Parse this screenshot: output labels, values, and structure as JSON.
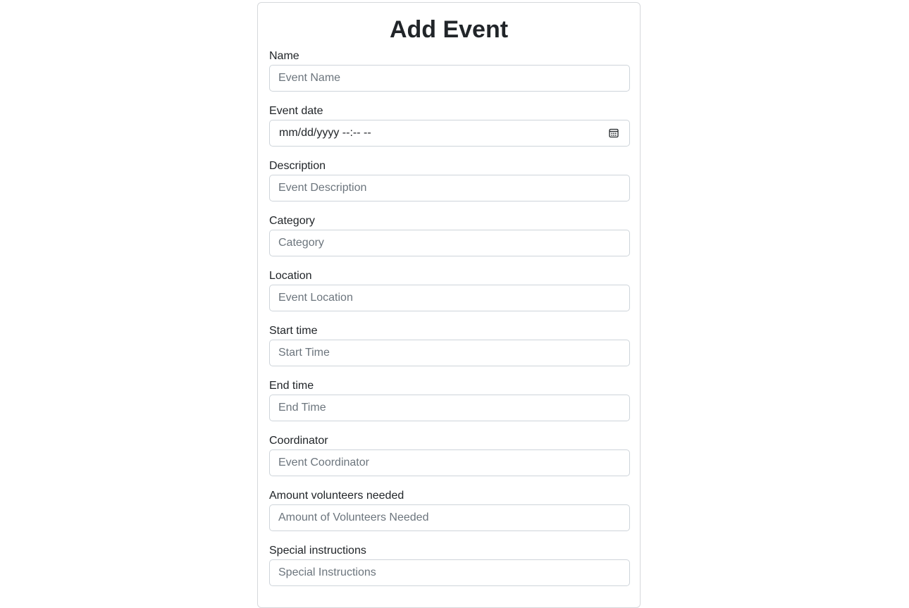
{
  "form": {
    "title": "Add Event",
    "fields": [
      {
        "label": "Name",
        "placeholder": "Event Name"
      },
      {
        "label": "Event date",
        "value": "mm/dd/yyyy --:-- --"
      },
      {
        "label": "Description",
        "placeholder": "Event Description"
      },
      {
        "label": "Category",
        "placeholder": "Category"
      },
      {
        "label": "Location",
        "placeholder": "Event Location"
      },
      {
        "label": "Start time",
        "placeholder": "Start Time"
      },
      {
        "label": "End time",
        "placeholder": "End Time"
      },
      {
        "label": "Coordinator",
        "placeholder": "Event Coordinator"
      },
      {
        "label": "Amount volunteers needed",
        "placeholder": "Amount of Volunteers Needed"
      },
      {
        "label": "Special instructions",
        "placeholder": "Special Instructions"
      }
    ]
  },
  "icons": {
    "date_picker": "calendar-icon"
  }
}
